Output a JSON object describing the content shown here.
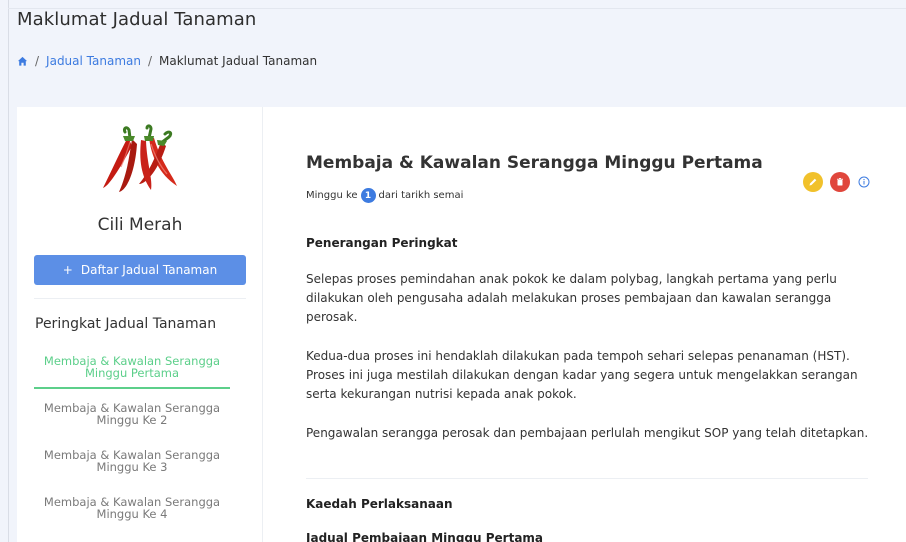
{
  "page": {
    "title": "Maklumat Jadual Tanaman"
  },
  "breadcrumb": {
    "home_icon": "home-icon",
    "separator": "/",
    "link_label": "Jadual Tanaman",
    "current_label": "Maklumat Jadual Tanaman"
  },
  "sidebar": {
    "plant_name": "Cili Merah",
    "plant_image": "red-chili-image",
    "add_button_icon": "+",
    "add_button_label": "Daftar Jadual Tanaman",
    "stages_title": "Peringkat Jadual Tanaman",
    "stages": [
      {
        "line1": "Membaja & Kawalan Serangga",
        "line2": "Minggu Pertama",
        "active": true
      },
      {
        "line1": "Membaja & Kawalan Serangga",
        "line2": "Minggu Ke 2",
        "active": false
      },
      {
        "line1": "Membaja & Kawalan Serangga",
        "line2": "Minggu Ke 3",
        "active": false
      },
      {
        "line1": "Membaja & Kawalan Serangga",
        "line2": "Minggu Ke 4",
        "active": false
      }
    ]
  },
  "content": {
    "title": "Membaja & Kawalan Serangga Minggu Pertama",
    "week_prefix": "Minggu ke",
    "week_number": "1",
    "week_suffix": "dari tarikh semai",
    "actions": {
      "edit_icon": "pencil-icon",
      "delete_icon": "trash-icon",
      "info_icon": "info-icon"
    },
    "section1_heading": "Penerangan Peringkat",
    "paragraphs": [
      "Selepas proses pemindahan anak pokok ke dalam polybag, langkah pertama yang perlu dilakukan oleh pengusaha adalah melakukan proses pembajaan dan kawalan serangga perosak.",
      "Kedua-dua proses ini hendaklah dilakukan pada tempoh sehari selepas penanaman (HST). Proses ini juga mestilah dilakukan dengan kadar yang segera untuk mengelakkan serangan serta kekurangan nutrisi kepada anak pokok.",
      "Pengawalan serangga perosak dan pembajaan perlulah mengikut SOP yang telah ditetapkan."
    ],
    "section2_heading": "Kaedah Perlaksanaan",
    "section3_heading": "Jadual Pembajaan Minggu Pertama"
  },
  "colors": {
    "accent_blue": "#3d7be0",
    "button_blue": "#5c8fe6",
    "active_green": "#5ccf8a",
    "edit_yellow": "#f1c12b",
    "delete_red": "#e0463c"
  }
}
